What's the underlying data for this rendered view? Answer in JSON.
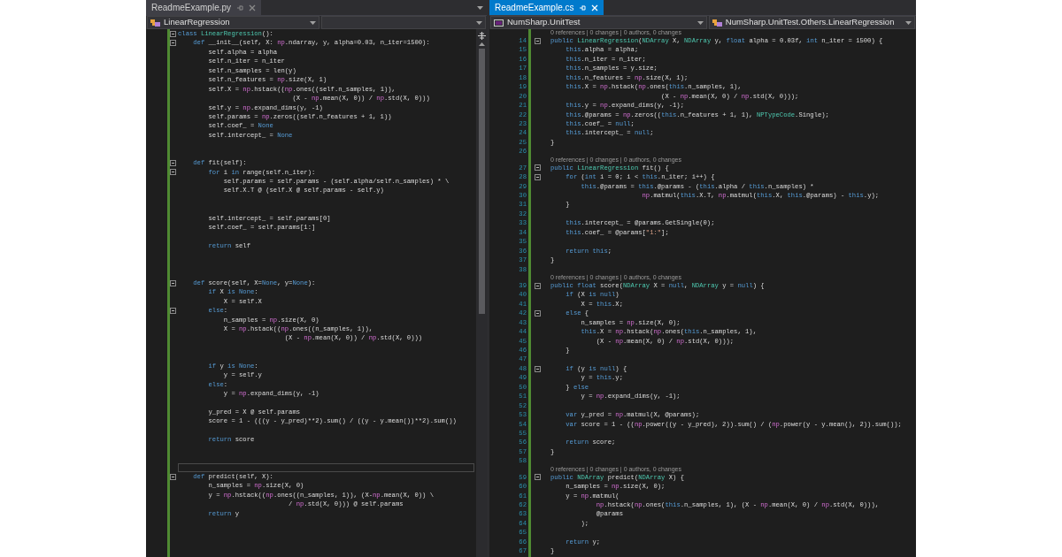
{
  "panes": [
    {
      "tab": {
        "label": "ReadmeExample.py",
        "selected": false
      },
      "tab_menu": true,
      "scrollbar": true,
      "nav": [
        {
          "kind": "class",
          "text": "LinearRegression"
        },
        {
          "kind": "empty"
        }
      ],
      "lines": [
        {
          "kind": "code",
          "fold": true,
          "tokens": [
            {
              "text": "class ",
              "kind": "keyword"
            },
            {
              "text": "LinearRegression",
              "kind": "type"
            },
            {
              "text": "():",
              "kind": "plain"
            }
          ]
        },
        {
          "kind": "code",
          "fold": true,
          "tokens": [
            {
              "text": "    def ",
              "kind": "keyword"
            },
            {
              "text": "__init__(self, X: ",
              "kind": "plain"
            },
            {
              "text": "np",
              "kind": "module"
            },
            {
              "text": ".ndarray, y, alpha=0.03, n_iter=1500):",
              "kind": "plain"
            }
          ]
        },
        {
          "kind": "code",
          "tokens": [
            {
              "text": "        self.alpha = alpha",
              "kind": "plain"
            }
          ]
        },
        {
          "kind": "code",
          "tokens": [
            {
              "text": "        self.n_iter = n_iter",
              "kind": "plain"
            }
          ]
        },
        {
          "kind": "code",
          "tokens": [
            {
              "text": "        self.n_samples = len(y)",
              "kind": "plain"
            }
          ]
        },
        {
          "kind": "code",
          "tokens": [
            {
              "text": "        self.n_features = ",
              "kind": "plain"
            },
            {
              "text": "np",
              "kind": "module"
            },
            {
              "text": ".size(X, 1)",
              "kind": "plain"
            }
          ]
        },
        {
          "kind": "code",
          "tokens": [
            {
              "text": "        self.X = ",
              "kind": "plain"
            },
            {
              "text": "np",
              "kind": "module"
            },
            {
              "text": ".hstack((",
              "kind": "plain"
            },
            {
              "text": "np",
              "kind": "module"
            },
            {
              "text": ".ones((self.n_samples, 1)),",
              "kind": "plain"
            }
          ]
        },
        {
          "kind": "code",
          "tokens": [
            {
              "text": "                              (X - ",
              "kind": "plain"
            },
            {
              "text": "np",
              "kind": "module"
            },
            {
              "text": ".mean(X, 0)) / ",
              "kind": "plain"
            },
            {
              "text": "np",
              "kind": "module"
            },
            {
              "text": ".std(X, 0)))",
              "kind": "plain"
            }
          ]
        },
        {
          "kind": "code",
          "tokens": [
            {
              "text": "        self.y = ",
              "kind": "plain"
            },
            {
              "text": "np",
              "kind": "module"
            },
            {
              "text": ".expand_dims(y, -1)",
              "kind": "plain"
            }
          ]
        },
        {
          "kind": "code",
          "tokens": [
            {
              "text": "        self.params = ",
              "kind": "plain"
            },
            {
              "text": "np",
              "kind": "module"
            },
            {
              "text": ".zeros((self.n_features + 1, 1))",
              "kind": "plain"
            }
          ]
        },
        {
          "kind": "code",
          "tokens": [
            {
              "text": "        self.coef_ = ",
              "kind": "plain"
            },
            {
              "text": "None",
              "kind": "keyword"
            }
          ]
        },
        {
          "kind": "code",
          "tokens": [
            {
              "text": "        self.intercept_ = ",
              "kind": "plain"
            },
            {
              "text": "None",
              "kind": "keyword"
            }
          ]
        },
        {
          "kind": "code"
        },
        {
          "kind": "code"
        },
        {
          "kind": "code",
          "fold": true,
          "tokens": [
            {
              "text": "    def ",
              "kind": "keyword"
            },
            {
              "text": "fit(self):",
              "kind": "plain"
            }
          ]
        },
        {
          "kind": "code",
          "fold": true,
          "tokens": [
            {
              "text": "        for",
              "kind": "keyword"
            },
            {
              "text": " i ",
              "kind": "plain"
            },
            {
              "text": "in",
              "kind": "keyword"
            },
            {
              "text": " range(self.n_iter):",
              "kind": "plain"
            }
          ]
        },
        {
          "kind": "code",
          "tokens": [
            {
              "text": "            self.params = self.params - (self.alpha/self.n_samples) * \\",
              "kind": "plain"
            }
          ]
        },
        {
          "kind": "code",
          "tokens": [
            {
              "text": "            self.X.T @ (self.X @ self.params - self.y)",
              "kind": "plain"
            }
          ]
        },
        {
          "kind": "code"
        },
        {
          "kind": "code"
        },
        {
          "kind": "code",
          "tokens": [
            {
              "text": "        self.intercept_ = self.params[0]",
              "kind": "plain"
            }
          ]
        },
        {
          "kind": "code",
          "tokens": [
            {
              "text": "        self.coef_ = self.params[1:]",
              "kind": "plain"
            }
          ]
        },
        {
          "kind": "code"
        },
        {
          "kind": "code",
          "tokens": [
            {
              "text": "        return",
              "kind": "keyword"
            },
            {
              "text": " self",
              "kind": "plain"
            }
          ]
        },
        {
          "kind": "code"
        },
        {
          "kind": "code"
        },
        {
          "kind": "code"
        },
        {
          "kind": "code",
          "fold": true,
          "tokens": [
            {
              "text": "    def ",
              "kind": "keyword"
            },
            {
              "text": "score(self, X=",
              "kind": "plain"
            },
            {
              "text": "None",
              "kind": "keyword"
            },
            {
              "text": ", y=",
              "kind": "plain"
            },
            {
              "text": "None",
              "kind": "keyword"
            },
            {
              "text": "):",
              "kind": "plain"
            }
          ]
        },
        {
          "kind": "code",
          "tokens": [
            {
              "text": "        if",
              "kind": "keyword"
            },
            {
              "text": " X ",
              "kind": "plain"
            },
            {
              "text": "is None",
              "kind": "keyword"
            },
            {
              "text": ":",
              "kind": "plain"
            }
          ]
        },
        {
          "kind": "code",
          "tokens": [
            {
              "text": "            X = self.X",
              "kind": "plain"
            }
          ]
        },
        {
          "kind": "code",
          "fold": true,
          "tokens": [
            {
              "text": "        else",
              "kind": "keyword"
            },
            {
              "text": ":",
              "kind": "plain"
            }
          ]
        },
        {
          "kind": "code",
          "tokens": [
            {
              "text": "            n_samples = ",
              "kind": "plain"
            },
            {
              "text": "np",
              "kind": "module"
            },
            {
              "text": ".size(X, 0)",
              "kind": "plain"
            }
          ]
        },
        {
          "kind": "code",
          "tokens": [
            {
              "text": "            X = ",
              "kind": "plain"
            },
            {
              "text": "np",
              "kind": "module"
            },
            {
              "text": ".hstack((",
              "kind": "plain"
            },
            {
              "text": "np",
              "kind": "module"
            },
            {
              "text": ".ones((n_samples, 1)),",
              "kind": "plain"
            }
          ]
        },
        {
          "kind": "code",
          "tokens": [
            {
              "text": "                            (X - ",
              "kind": "plain"
            },
            {
              "text": "np",
              "kind": "module"
            },
            {
              "text": ".mean(X, 0)) / ",
              "kind": "plain"
            },
            {
              "text": "np",
              "kind": "module"
            },
            {
              "text": ".std(X, 0)))",
              "kind": "plain"
            }
          ]
        },
        {
          "kind": "code"
        },
        {
          "kind": "code"
        },
        {
          "kind": "code",
          "tokens": [
            {
              "text": "        if",
              "kind": "keyword"
            },
            {
              "text": " y ",
              "kind": "plain"
            },
            {
              "text": "is None",
              "kind": "keyword"
            },
            {
              "text": ":",
              "kind": "plain"
            }
          ]
        },
        {
          "kind": "code",
          "tokens": [
            {
              "text": "            y = self.y",
              "kind": "plain"
            }
          ]
        },
        {
          "kind": "code",
          "tokens": [
            {
              "text": "        else",
              "kind": "keyword"
            },
            {
              "text": ":",
              "kind": "plain"
            }
          ]
        },
        {
          "kind": "code",
          "tokens": [
            {
              "text": "            y = ",
              "kind": "plain"
            },
            {
              "text": "np",
              "kind": "module"
            },
            {
              "text": ".expand_dims(y, -1)",
              "kind": "plain"
            }
          ]
        },
        {
          "kind": "code"
        },
        {
          "kind": "code",
          "tokens": [
            {
              "text": "        y_pred = X @ self.params",
              "kind": "plain"
            }
          ]
        },
        {
          "kind": "code",
          "tokens": [
            {
              "text": "        score = 1 - (((y - y_pred)**2).sum() / ((y - y.mean())**2).sum())",
              "kind": "plain"
            }
          ]
        },
        {
          "kind": "code"
        },
        {
          "kind": "code",
          "tokens": [
            {
              "text": "        return",
              "kind": "keyword"
            },
            {
              "text": " score",
              "kind": "plain"
            }
          ]
        },
        {
          "kind": "code"
        },
        {
          "kind": "code"
        },
        {
          "kind": "code",
          "current": true
        },
        {
          "kind": "code",
          "fold": true,
          "tokens": [
            {
              "text": "    def ",
              "kind": "keyword"
            },
            {
              "text": "predict(self, X):",
              "kind": "plain"
            }
          ]
        },
        {
          "kind": "code",
          "tokens": [
            {
              "text": "        n_samples = ",
              "kind": "plain"
            },
            {
              "text": "np",
              "kind": "module"
            },
            {
              "text": ".size(X, 0)",
              "kind": "plain"
            }
          ]
        },
        {
          "kind": "code",
          "tokens": [
            {
              "text": "        y = ",
              "kind": "plain"
            },
            {
              "text": "np",
              "kind": "module"
            },
            {
              "text": ".hstack((",
              "kind": "plain"
            },
            {
              "text": "np",
              "kind": "module"
            },
            {
              "text": ".ones((n_samples, 1)), (X-",
              "kind": "plain"
            },
            {
              "text": "np",
              "kind": "module"
            },
            {
              "text": ".mean(X, 0)) \\",
              "kind": "plain"
            }
          ]
        },
        {
          "kind": "code",
          "tokens": [
            {
              "text": "                             / ",
              "kind": "plain"
            },
            {
              "text": "np",
              "kind": "module"
            },
            {
              "text": ".std(X, 0))) @ self.params",
              "kind": "plain"
            }
          ]
        },
        {
          "kind": "code",
          "tokens": [
            {
              "text": "        return",
              "kind": "keyword"
            },
            {
              "text": " y",
              "kind": "plain"
            }
          ]
        }
      ]
    },
    {
      "tab": {
        "label": "ReadmeExample.cs",
        "selected": true
      },
      "nav": [
        {
          "kind": "project",
          "text": "NumSharp.UnitTest"
        },
        {
          "kind": "class",
          "text": "NumSharp.UnitTest.Others.LinearRegression"
        }
      ],
      "lines": [
        {
          "kind": "codelens",
          "text": "0 references | 0 changes | 0 authors, 0 changes"
        },
        {
          "kind": "code",
          "number": "14",
          "fold": true,
          "tokens": [
            {
              "text": "public ",
              "kind": "keyword"
            },
            {
              "text": "LinearRegression",
              "kind": "type"
            },
            {
              "text": "(",
              "kind": "plain"
            },
            {
              "text": "NDArray",
              "kind": "type"
            },
            {
              "text": " X, ",
              "kind": "plain"
            },
            {
              "text": "NDArray",
              "kind": "type"
            },
            {
              "text": " y, ",
              "kind": "plain"
            },
            {
              "text": "float",
              "kind": "keyword"
            },
            {
              "text": " alpha = 0.03f, ",
              "kind": "plain"
            },
            {
              "text": "int",
              "kind": "keyword"
            },
            {
              "text": " n_iter = 1500) {",
              "kind": "plain"
            }
          ]
        },
        {
          "kind": "code",
          "number": "15",
          "tokens": [
            {
              "text": "    this",
              "kind": "keyword"
            },
            {
              "text": ".alpha = alpha;",
              "kind": "plain"
            }
          ]
        },
        {
          "kind": "code",
          "number": "16",
          "tokens": [
            {
              "text": "    this",
              "kind": "keyword"
            },
            {
              "text": ".n_iter = n_iter;",
              "kind": "plain"
            }
          ]
        },
        {
          "kind": "code",
          "number": "17",
          "tokens": [
            {
              "text": "    this",
              "kind": "keyword"
            },
            {
              "text": ".n_samples = y.size;",
              "kind": "plain"
            }
          ]
        },
        {
          "kind": "code",
          "number": "18",
          "tokens": [
            {
              "text": "    this",
              "kind": "keyword"
            },
            {
              "text": ".n_features = ",
              "kind": "plain"
            },
            {
              "text": "np",
              "kind": "module"
            },
            {
              "text": ".size(X, 1);",
              "kind": "plain"
            }
          ]
        },
        {
          "kind": "code",
          "number": "19",
          "tokens": [
            {
              "text": "    this",
              "kind": "keyword"
            },
            {
              "text": ".X = ",
              "kind": "plain"
            },
            {
              "text": "np",
              "kind": "module"
            },
            {
              "text": ".hstack(",
              "kind": "plain"
            },
            {
              "text": "np",
              "kind": "module"
            },
            {
              "text": ".ones(",
              "kind": "plain"
            },
            {
              "text": "this",
              "kind": "keyword"
            },
            {
              "text": ".n_samples, 1),",
              "kind": "plain"
            }
          ]
        },
        {
          "kind": "code",
          "number": "20",
          "tokens": [
            {
              "text": "                             (X - ",
              "kind": "plain"
            },
            {
              "text": "np",
              "kind": "module"
            },
            {
              "text": ".mean(X, 0) / ",
              "kind": "plain"
            },
            {
              "text": "np",
              "kind": "module"
            },
            {
              "text": ".std(X, 0)));",
              "kind": "plain"
            }
          ]
        },
        {
          "kind": "code",
          "number": "21",
          "tokens": [
            {
              "text": "    this",
              "kind": "keyword"
            },
            {
              "text": ".y = ",
              "kind": "plain"
            },
            {
              "text": "np",
              "kind": "module"
            },
            {
              "text": ".expand_dims(y, -1);",
              "kind": "plain"
            }
          ]
        },
        {
          "kind": "code",
          "number": "22",
          "tokens": [
            {
              "text": "    this",
              "kind": "keyword"
            },
            {
              "text": ".@params = ",
              "kind": "plain"
            },
            {
              "text": "np",
              "kind": "module"
            },
            {
              "text": ".zeros((",
              "kind": "plain"
            },
            {
              "text": "this",
              "kind": "keyword"
            },
            {
              "text": ".n_features + 1, 1), ",
              "kind": "plain"
            },
            {
              "text": "NPTypeCode",
              "kind": "type"
            },
            {
              "text": ".Single);",
              "kind": "plain"
            }
          ]
        },
        {
          "kind": "code",
          "number": "23",
          "tokens": [
            {
              "text": "    this",
              "kind": "keyword"
            },
            {
              "text": ".coef_ = ",
              "kind": "plain"
            },
            {
              "text": "null",
              "kind": "keyword"
            },
            {
              "text": ";",
              "kind": "plain"
            }
          ]
        },
        {
          "kind": "code",
          "number": "24",
          "tokens": [
            {
              "text": "    this",
              "kind": "keyword"
            },
            {
              "text": ".intercept_ = ",
              "kind": "plain"
            },
            {
              "text": "null",
              "kind": "keyword"
            },
            {
              "text": ";",
              "kind": "plain"
            }
          ]
        },
        {
          "kind": "code",
          "number": "25",
          "tokens": [
            {
              "text": "}",
              "kind": "plain"
            }
          ]
        },
        {
          "kind": "code",
          "number": "26"
        },
        {
          "kind": "codelens",
          "text": "0 references | 0 changes | 0 authors, 0 changes"
        },
        {
          "kind": "code",
          "number": "27",
          "fold": true,
          "tokens": [
            {
              "text": "public ",
              "kind": "keyword"
            },
            {
              "text": "LinearRegression",
              "kind": "type"
            },
            {
              "text": " fit() {",
              "kind": "plain"
            }
          ]
        },
        {
          "kind": "code",
          "number": "28",
          "fold": true,
          "tokens": [
            {
              "text": "    for",
              "kind": "keyword"
            },
            {
              "text": " (",
              "kind": "plain"
            },
            {
              "text": "int",
              "kind": "keyword"
            },
            {
              "text": " i = 0; i < ",
              "kind": "plain"
            },
            {
              "text": "this",
              "kind": "keyword"
            },
            {
              "text": ".n_iter; i++) {",
              "kind": "plain"
            }
          ]
        },
        {
          "kind": "code",
          "number": "29",
          "tokens": [
            {
              "text": "        this",
              "kind": "keyword"
            },
            {
              "text": ".@params = ",
              "kind": "plain"
            },
            {
              "text": "this",
              "kind": "keyword"
            },
            {
              "text": ".@params - (",
              "kind": "plain"
            },
            {
              "text": "this",
              "kind": "keyword"
            },
            {
              "text": ".alpha / ",
              "kind": "plain"
            },
            {
              "text": "this",
              "kind": "keyword"
            },
            {
              "text": ".n_samples) *",
              "kind": "plain"
            }
          ]
        },
        {
          "kind": "code",
          "number": "30",
          "tokens": [
            {
              "text": "                        np",
              "kind": "module"
            },
            {
              "text": ".matmul(",
              "kind": "plain"
            },
            {
              "text": "this",
              "kind": "keyword"
            },
            {
              "text": ".X.T, ",
              "kind": "plain"
            },
            {
              "text": "np",
              "kind": "module"
            },
            {
              "text": ".matmul(",
              "kind": "plain"
            },
            {
              "text": "this",
              "kind": "keyword"
            },
            {
              "text": ".X, ",
              "kind": "plain"
            },
            {
              "text": "this",
              "kind": "keyword"
            },
            {
              "text": ".@params) - ",
              "kind": "plain"
            },
            {
              "text": "this",
              "kind": "keyword"
            },
            {
              "text": ".y);",
              "kind": "plain"
            }
          ]
        },
        {
          "kind": "code",
          "number": "31",
          "tokens": [
            {
              "text": "    }",
              "kind": "plain"
            }
          ]
        },
        {
          "kind": "code",
          "number": "32"
        },
        {
          "kind": "code",
          "number": "33",
          "tokens": [
            {
              "text": "    this",
              "kind": "keyword"
            },
            {
              "text": ".intercept_ = @params.GetSingle(0);",
              "kind": "plain"
            }
          ]
        },
        {
          "kind": "code",
          "number": "34",
          "tokens": [
            {
              "text": "    this",
              "kind": "keyword"
            },
            {
              "text": ".coef_ = @params[",
              "kind": "plain"
            },
            {
              "text": "\"1:\"",
              "kind": "string"
            },
            {
              "text": "];",
              "kind": "plain"
            }
          ]
        },
        {
          "kind": "code",
          "number": "35"
        },
        {
          "kind": "code",
          "number": "36",
          "tokens": [
            {
              "text": "    return this",
              "kind": "keyword"
            },
            {
              "text": ";",
              "kind": "plain"
            }
          ]
        },
        {
          "kind": "code",
          "number": "37",
          "tokens": [
            {
              "text": "}",
              "kind": "plain"
            }
          ]
        },
        {
          "kind": "code",
          "number": "38"
        },
        {
          "kind": "codelens",
          "text": "0 references | 0 changes | 0 authors, 0 changes"
        },
        {
          "kind": "code",
          "number": "39",
          "fold": true,
          "tokens": [
            {
              "text": "public float ",
              "kind": "keyword"
            },
            {
              "text": "score(",
              "kind": "plain"
            },
            {
              "text": "NDArray",
              "kind": "type"
            },
            {
              "text": " X = ",
              "kind": "plain"
            },
            {
              "text": "null",
              "kind": "keyword"
            },
            {
              "text": ", ",
              "kind": "plain"
            },
            {
              "text": "NDArray",
              "kind": "type"
            },
            {
              "text": " y = ",
              "kind": "plain"
            },
            {
              "text": "null",
              "kind": "keyword"
            },
            {
              "text": ") {",
              "kind": "plain"
            }
          ]
        },
        {
          "kind": "code",
          "number": "40",
          "tokens": [
            {
              "text": "    if",
              "kind": "keyword"
            },
            {
              "text": " (X ",
              "kind": "plain"
            },
            {
              "text": "is null",
              "kind": "keyword"
            },
            {
              "text": ")",
              "kind": "plain"
            }
          ]
        },
        {
          "kind": "code",
          "number": "41",
          "tokens": [
            {
              "text": "        X = ",
              "kind": "plain"
            },
            {
              "text": "this",
              "kind": "keyword"
            },
            {
              "text": ".X;",
              "kind": "plain"
            }
          ]
        },
        {
          "kind": "code",
          "number": "42",
          "fold": true,
          "tokens": [
            {
              "text": "    else",
              "kind": "keyword"
            },
            {
              "text": " {",
              "kind": "plain"
            }
          ]
        },
        {
          "kind": "code",
          "number": "43",
          "tokens": [
            {
              "text": "        n_samples = ",
              "kind": "plain"
            },
            {
              "text": "np",
              "kind": "module"
            },
            {
              "text": ".size(X, 0);",
              "kind": "plain"
            }
          ]
        },
        {
          "kind": "code",
          "number": "44",
          "tokens": [
            {
              "text": "        this",
              "kind": "keyword"
            },
            {
              "text": ".X = ",
              "kind": "plain"
            },
            {
              "text": "np",
              "kind": "module"
            },
            {
              "text": ".hstack(",
              "kind": "plain"
            },
            {
              "text": "np",
              "kind": "module"
            },
            {
              "text": ".ones(",
              "kind": "plain"
            },
            {
              "text": "this",
              "kind": "keyword"
            },
            {
              "text": ".n_samples, 1),",
              "kind": "plain"
            }
          ]
        },
        {
          "kind": "code",
          "number": "45",
          "tokens": [
            {
              "text": "            (X - ",
              "kind": "plain"
            },
            {
              "text": "np",
              "kind": "module"
            },
            {
              "text": ".mean(X, 0) / ",
              "kind": "plain"
            },
            {
              "text": "np",
              "kind": "module"
            },
            {
              "text": ".std(X, 0)));",
              "kind": "plain"
            }
          ]
        },
        {
          "kind": "code",
          "number": "46",
          "tokens": [
            {
              "text": "    }",
              "kind": "plain"
            }
          ]
        },
        {
          "kind": "code",
          "number": "47"
        },
        {
          "kind": "code",
          "number": "48",
          "fold": true,
          "tokens": [
            {
              "text": "    if",
              "kind": "keyword"
            },
            {
              "text": " (y ",
              "kind": "plain"
            },
            {
              "text": "is null",
              "kind": "keyword"
            },
            {
              "text": ") {",
              "kind": "plain"
            }
          ]
        },
        {
          "kind": "code",
          "number": "49",
          "tokens": [
            {
              "text": "        y = ",
              "kind": "plain"
            },
            {
              "text": "this",
              "kind": "keyword"
            },
            {
              "text": ".y;",
              "kind": "plain"
            }
          ]
        },
        {
          "kind": "code",
          "number": "50",
          "tokens": [
            {
              "text": "    } ",
              "kind": "plain"
            },
            {
              "text": "else",
              "kind": "keyword"
            }
          ]
        },
        {
          "kind": "code",
          "number": "51",
          "tokens": [
            {
              "text": "        y = ",
              "kind": "plain"
            },
            {
              "text": "np",
              "kind": "module"
            },
            {
              "text": ".expand_dims(y, -1);",
              "kind": "plain"
            }
          ]
        },
        {
          "kind": "code",
          "number": "52"
        },
        {
          "kind": "code",
          "number": "53",
          "tokens": [
            {
              "text": "    var",
              "kind": "keyword"
            },
            {
              "text": " y_pred = ",
              "kind": "plain"
            },
            {
              "text": "np",
              "kind": "module"
            },
            {
              "text": ".matmul(X, @params);",
              "kind": "plain"
            }
          ]
        },
        {
          "kind": "code",
          "number": "54",
          "tokens": [
            {
              "text": "    var",
              "kind": "keyword"
            },
            {
              "text": " score = 1 - ((",
              "kind": "plain"
            },
            {
              "text": "np",
              "kind": "module"
            },
            {
              "text": ".power((y - y_pred), 2)).sum() / (",
              "kind": "plain"
            },
            {
              "text": "np",
              "kind": "module"
            },
            {
              "text": ".power(y - y.mean(), 2)).sum());",
              "kind": "plain"
            }
          ]
        },
        {
          "kind": "code",
          "number": "55"
        },
        {
          "kind": "code",
          "number": "56",
          "tokens": [
            {
              "text": "    return",
              "kind": "keyword"
            },
            {
              "text": " score;",
              "kind": "plain"
            }
          ]
        },
        {
          "kind": "code",
          "number": "57",
          "tokens": [
            {
              "text": "}",
              "kind": "plain"
            }
          ]
        },
        {
          "kind": "code",
          "number": "58"
        },
        {
          "kind": "codelens",
          "text": "0 references | 0 changes | 0 authors, 0 changes"
        },
        {
          "kind": "code",
          "number": "59",
          "fold": true,
          "tokens": [
            {
              "text": "public ",
              "kind": "keyword"
            },
            {
              "text": "NDArray",
              "kind": "type"
            },
            {
              "text": " predict(",
              "kind": "plain"
            },
            {
              "text": "NDArray",
              "kind": "type"
            },
            {
              "text": " X) {",
              "kind": "plain"
            }
          ]
        },
        {
          "kind": "code",
          "number": "60",
          "tokens": [
            {
              "text": "    n_samples = ",
              "kind": "plain"
            },
            {
              "text": "np",
              "kind": "module"
            },
            {
              "text": ".size(X, 0);",
              "kind": "plain"
            }
          ]
        },
        {
          "kind": "code",
          "number": "61",
          "tokens": [
            {
              "text": "    y = ",
              "kind": "plain"
            },
            {
              "text": "np",
              "kind": "module"
            },
            {
              "text": ".matmul(",
              "kind": "plain"
            }
          ]
        },
        {
          "kind": "code",
          "number": "62",
          "tokens": [
            {
              "text": "            np",
              "kind": "module"
            },
            {
              "text": ".hstack(",
              "kind": "plain"
            },
            {
              "text": "np",
              "kind": "module"
            },
            {
              "text": ".ones(",
              "kind": "plain"
            },
            {
              "text": "this",
              "kind": "keyword"
            },
            {
              "text": ".n_samples, 1), (X - ",
              "kind": "plain"
            },
            {
              "text": "np",
              "kind": "module"
            },
            {
              "text": ".mean(X, 0) / ",
              "kind": "plain"
            },
            {
              "text": "np",
              "kind": "module"
            },
            {
              "text": ".std(X, 0))),",
              "kind": "plain"
            }
          ]
        },
        {
          "kind": "code",
          "number": "63",
          "tokens": [
            {
              "text": "            @params",
              "kind": "plain"
            }
          ]
        },
        {
          "kind": "code",
          "number": "64",
          "tokens": [
            {
              "text": "        );",
              "kind": "plain"
            }
          ]
        },
        {
          "kind": "code",
          "number": "65"
        },
        {
          "kind": "code",
          "number": "66",
          "tokens": [
            {
              "text": "    return",
              "kind": "keyword"
            },
            {
              "text": " y;",
              "kind": "plain"
            }
          ]
        },
        {
          "kind": "code",
          "number": "67",
          "tokens": [
            {
              "text": "}",
              "kind": "plain"
            }
          ]
        }
      ]
    }
  ]
}
